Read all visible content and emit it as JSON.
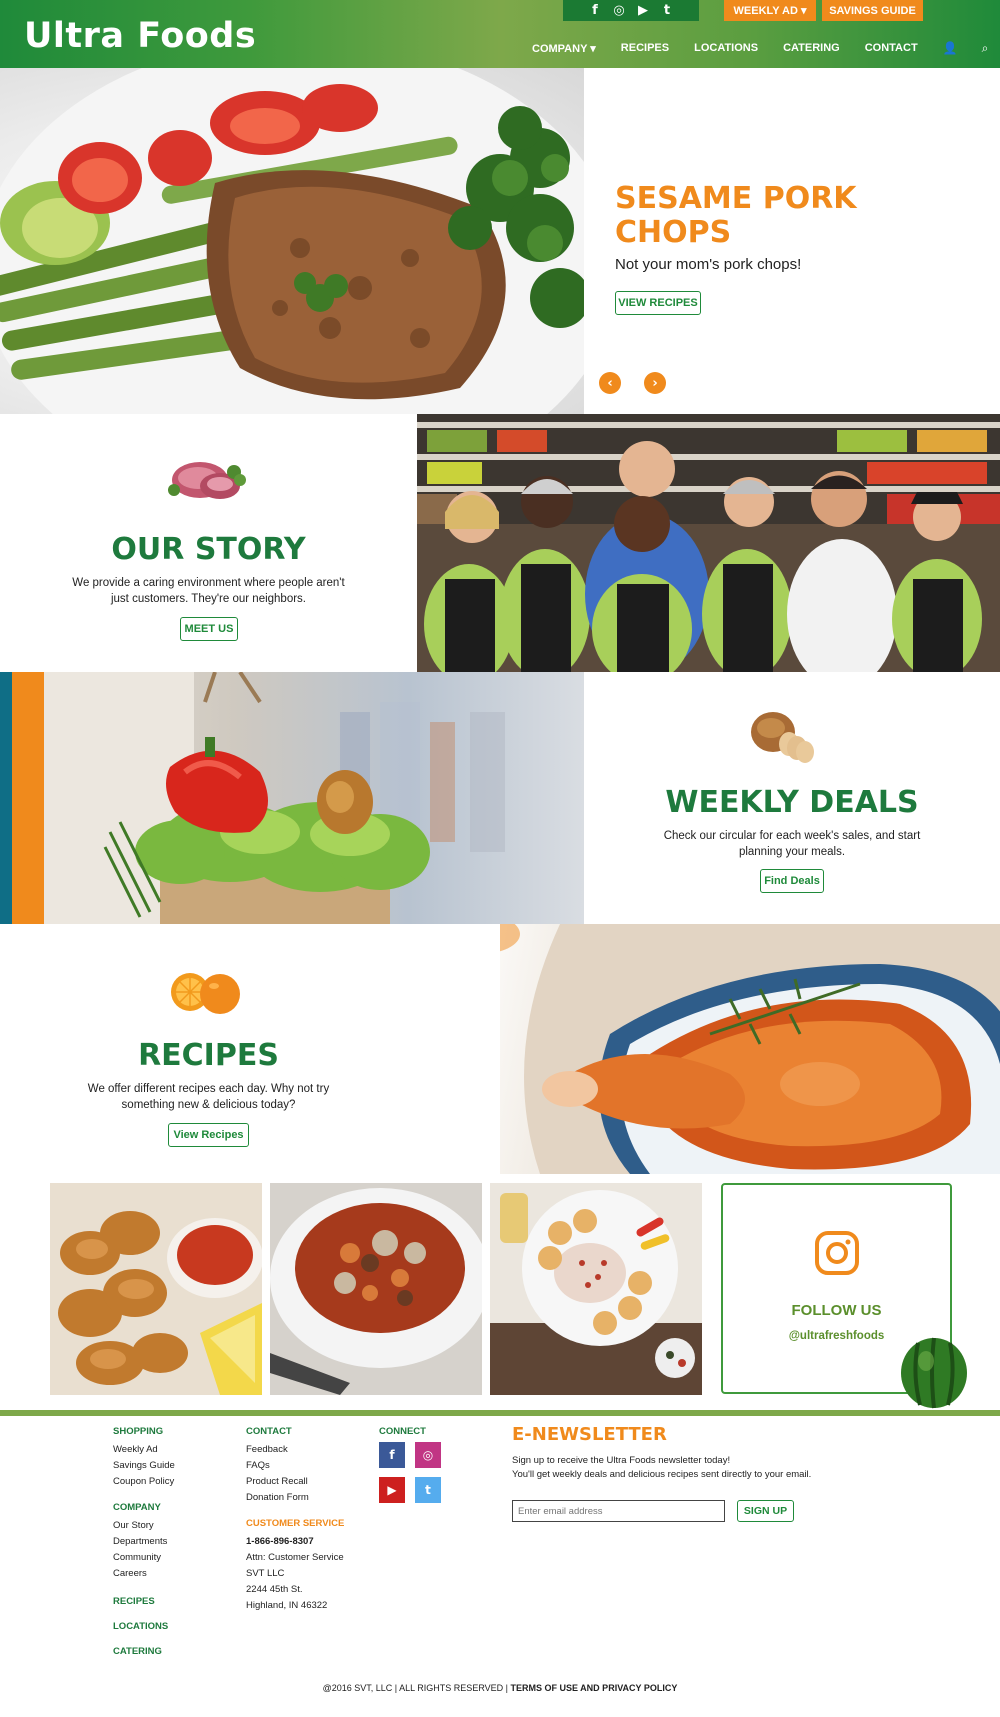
{
  "header": {
    "logo": "Ultra Foods",
    "social": [
      "f",
      "◎",
      "▶",
      "t"
    ],
    "weekly_ad": "WEEKLY AD ▾",
    "savings_guide": "SAVINGS GUIDE",
    "nav": [
      "COMPANY ▾",
      "RECIPES",
      "LOCATIONS",
      "CATERING",
      "CONTACT"
    ],
    "user_icon": "👤",
    "search_icon": "⌕"
  },
  "hero": {
    "title": "SESAME PORK CHOPS",
    "subtitle": "Not your mom's pork chops!",
    "button": "VIEW RECIPES",
    "prev": "‹",
    "next": "›"
  },
  "story": {
    "title": "OUR STORY",
    "text": "We provide a caring environment where people aren't just customers. They're our neighbors.",
    "button": "MEET US"
  },
  "deals": {
    "title": "WEEKLY DEALS",
    "text": "Check our circular for each week's sales, and start planning your meals.",
    "button": "Find Deals"
  },
  "recipes": {
    "title": "RECIPES",
    "text": "We offer different recipes each day. Why not try something new & delicious today?",
    "button": "View Recipes"
  },
  "follow": {
    "title": "FOLLOW US",
    "handle": "@ultrafreshfoods"
  },
  "footer": {
    "shopping": {
      "title": "SHOPPING",
      "links": [
        "Weekly Ad",
        "Savings Guide",
        "Coupon Policy"
      ]
    },
    "company": {
      "title": "COMPANY",
      "links": [
        "Our Story",
        "Departments",
        "Community",
        "Careers"
      ]
    },
    "recipes": "RECIPES",
    "locations": "LOCATIONS",
    "catering": "CATERING",
    "contact": {
      "title": "CONTACT",
      "links": [
        "Feedback",
        "FAQs",
        "Product Recall",
        "Donation Form"
      ]
    },
    "customer_service": {
      "title": "CUSTOMER SERVICE",
      "phone": "1-866-896-8307",
      "lines": [
        "Attn: Customer Service",
        "SVT LLC",
        "2244 45th St.",
        "Highland, IN 46322"
      ]
    },
    "connect": {
      "title": "CONNECT",
      "icons": [
        "f",
        "◎",
        "▶",
        "t"
      ]
    },
    "enewsletter": {
      "title": "E-NEWSLETTER",
      "line1": "Sign up to receive the Ultra Foods newsletter today!",
      "line2": "You'll get weekly deals and delicious recipes sent directly to your email.",
      "placeholder": "Enter email address",
      "button": "SIGN UP"
    },
    "copyright": "@2016 SVT, LLC | ALL RIGHTS RESERVED |",
    "terms": "TERMS OF USE AND PRIVACY POLICY"
  },
  "colors": {
    "brand_green": "#1e7a3d",
    "accent_orange": "#f08a1c",
    "light_green": "#7ea84a"
  }
}
